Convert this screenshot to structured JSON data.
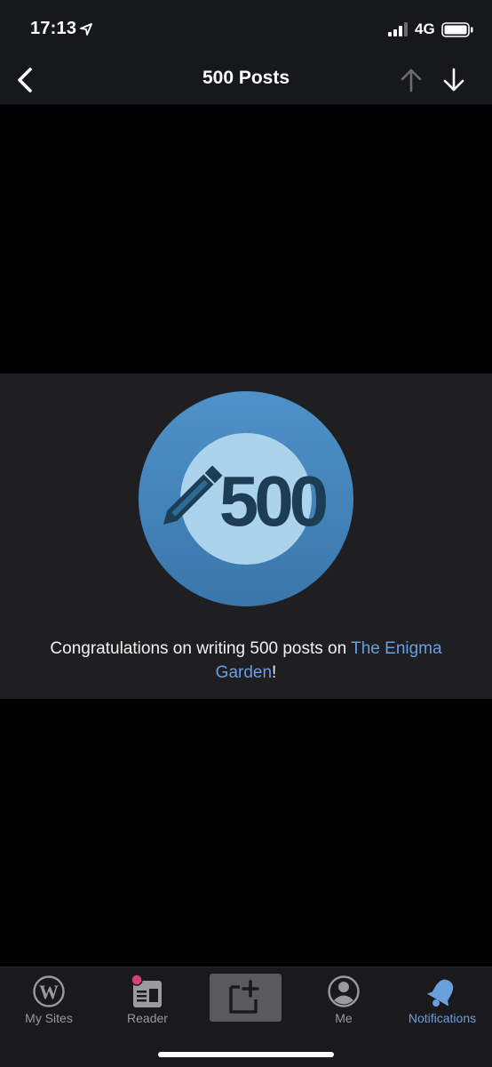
{
  "status_bar": {
    "time": "17:13",
    "network": "4G"
  },
  "nav": {
    "title": "500 Posts"
  },
  "badge": {
    "number": "500",
    "outer_color": "#4b8cc4",
    "inner_color": "#abd3eb",
    "text_color": "#1d3d55"
  },
  "message": {
    "prefix": "Congratulations on writing 500 posts on ",
    "site_name": "The Enigma Garden",
    "suffix": "!"
  },
  "tabs": [
    {
      "label": "My Sites",
      "icon": "wordpress-icon"
    },
    {
      "label": "Reader",
      "icon": "reader-icon"
    },
    {
      "label": "",
      "icon": "write-post-icon"
    },
    {
      "label": "Me",
      "icon": "user-icon"
    },
    {
      "label": "Notifications",
      "icon": "bell-icon"
    }
  ],
  "colors": {
    "accent": "#6a9fde",
    "unread_dot": "#d9417a",
    "tab_inactive": "#9a9a9f"
  }
}
